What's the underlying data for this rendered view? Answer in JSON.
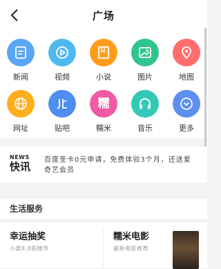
{
  "header": {
    "title": "广场"
  },
  "grid": [
    {
      "label": "新闻",
      "icon": "news-icon",
      "color": "#5aa6f2"
    },
    {
      "label": "视频",
      "icon": "play-icon",
      "color": "#4fb8ee"
    },
    {
      "label": "小说",
      "icon": "book-icon",
      "color": "#ff9d1a"
    },
    {
      "label": "图片",
      "icon": "image-icon",
      "color": "#2fc48e"
    },
    {
      "label": "地图",
      "icon": "map-pin-icon",
      "color": "#ff6d6d"
    },
    {
      "label": "网址",
      "icon": "globe-icon",
      "color": "#ffae1c"
    },
    {
      "label": "贴吧",
      "icon": "tieba-icon",
      "color": "#4d8ef0"
    },
    {
      "label": "糯米",
      "icon": "nuomi-icon",
      "color": "#f05ba3"
    },
    {
      "label": "音乐",
      "icon": "headphones-icon",
      "color": "#33c9b7"
    },
    {
      "label": "更多",
      "icon": "chevron-down-icon",
      "color": "#5c8ff0"
    }
  ],
  "news": {
    "logo_top": "NEWS",
    "logo_bottom": "快讯",
    "text": "百度圣卡0元申请，免费体验3个月，还送爱奇艺会员"
  },
  "section": {
    "title": "生活服务"
  },
  "cards": [
    {
      "title": "幸运抽奖",
      "subtitle": "小度8.8购物节"
    },
    {
      "title": "糯米电影",
      "subtitle": "最新电影推荐"
    }
  ]
}
